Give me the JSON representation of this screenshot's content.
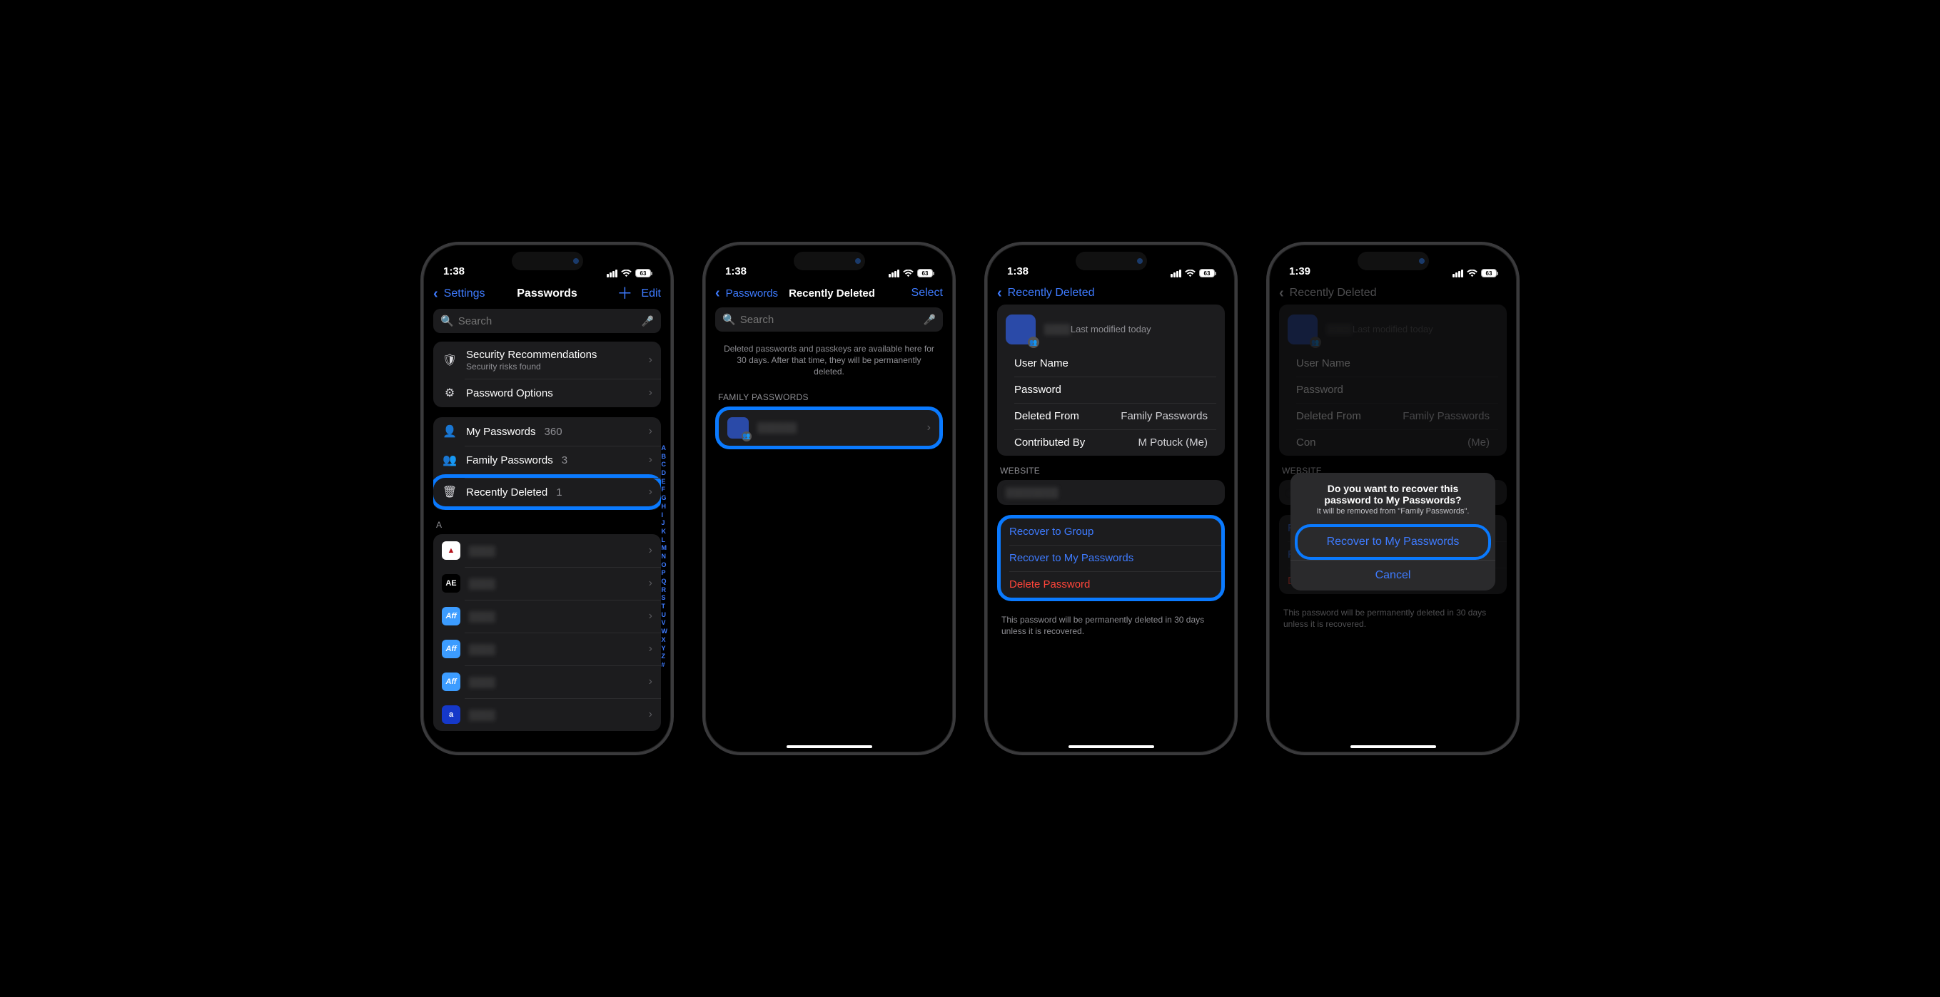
{
  "status": {
    "time1": "1:38",
    "time4": "1:39",
    "batt": "63"
  },
  "s1": {
    "back": "Settings",
    "title": "Passwords",
    "edit": "Edit",
    "searchPH": "Search",
    "secRec": "Security Recommendations",
    "secRecSub": "Security risks found",
    "passOpt": "Password Options",
    "myPw": "My Passwords",
    "myPwN": "360",
    "famPw": "Family Passwords",
    "famPwN": "3",
    "recDel": "Recently Deleted",
    "recDelN": "1",
    "sectA": "A",
    "idx": [
      "A",
      "B",
      "C",
      "D",
      "E",
      "F",
      "G",
      "H",
      "I",
      "J",
      "K",
      "L",
      "M",
      "N",
      "O",
      "P",
      "Q",
      "R",
      "S",
      "T",
      "U",
      "V",
      "W",
      "X",
      "Y",
      "Z",
      "#"
    ]
  },
  "s2": {
    "back": "Passwords",
    "title": "Recently Deleted",
    "select": "Select",
    "searchPH": "Search",
    "info": "Deleted passwords and passkeys are available here for 30 days. After that time, they will be permanently deleted.",
    "sect": "FAMILY PASSWORDS"
  },
  "s3": {
    "back": "Recently Deleted",
    "meta": "Last modified today",
    "user": "User Name",
    "pass": "Password",
    "delFrom": "Deleted From",
    "delFromV": "Family Passwords",
    "contrib": "Contributed By",
    "contribV": "M Potuck (Me)",
    "website": "WEBSITE",
    "recGroup": "Recover to Group",
    "recMy": "Recover to My Passwords",
    "delete": "Delete Password",
    "foot": "This password will be permanently deleted in 30 days unless it is recovered."
  },
  "s4": {
    "sheetTitle": "Do you want to recover this password to My Passwords?",
    "sheetSub": "It will be removed from \"Family Passwords\".",
    "sheetAct": "Recover to My Passwords",
    "sheetCancel": "Cancel"
  }
}
